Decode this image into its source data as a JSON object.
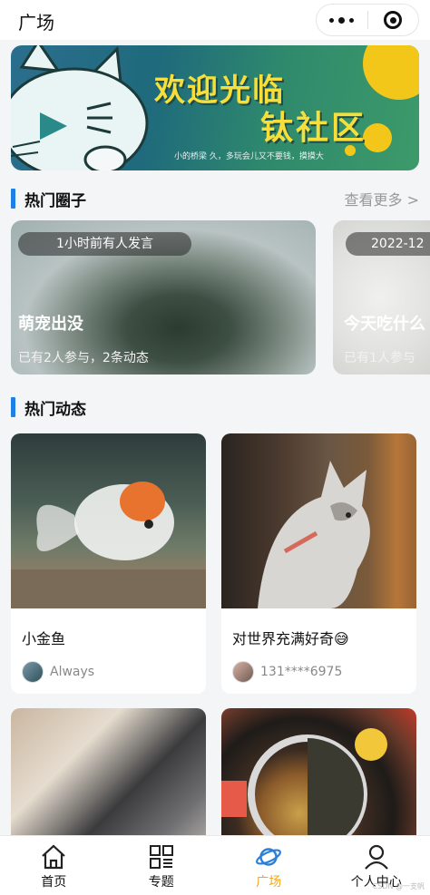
{
  "header": {
    "title": "广场",
    "more_icon": "more-dots-icon",
    "close_icon": "target-icon"
  },
  "banner": {
    "line1": "欢迎光临",
    "line2": "钛社区",
    "caption": "小的桥梁 久，多玩会儿又不要钱，摸摸大"
  },
  "hot_circles": {
    "title": "热门圈子",
    "more": "查看更多 >",
    "items": [
      {
        "time": "1小时前有人发言",
        "name": "萌宠出没",
        "stats": "已有2人参与，2条动态"
      },
      {
        "time": "2022-12",
        "name": "今天吃什么",
        "stats": "已有1人参与"
      }
    ]
  },
  "hot_posts": {
    "title": "热门动态",
    "items": [
      {
        "title": "小金鱼",
        "author": "Always"
      },
      {
        "title": "对世界充满好奇😅",
        "author": "131****6975"
      },
      {
        "title": "",
        "author": ""
      },
      {
        "title": "",
        "author": ""
      }
    ]
  },
  "tabbar": {
    "items": [
      {
        "label": "首页",
        "icon": "home-icon"
      },
      {
        "label": "专题",
        "icon": "grid-icon"
      },
      {
        "label": "广场",
        "icon": "planet-icon"
      },
      {
        "label": "个人中心",
        "icon": "user-icon"
      }
    ],
    "active_color": "#f0a81c"
  },
  "watermark": "CSDN @一支帆"
}
